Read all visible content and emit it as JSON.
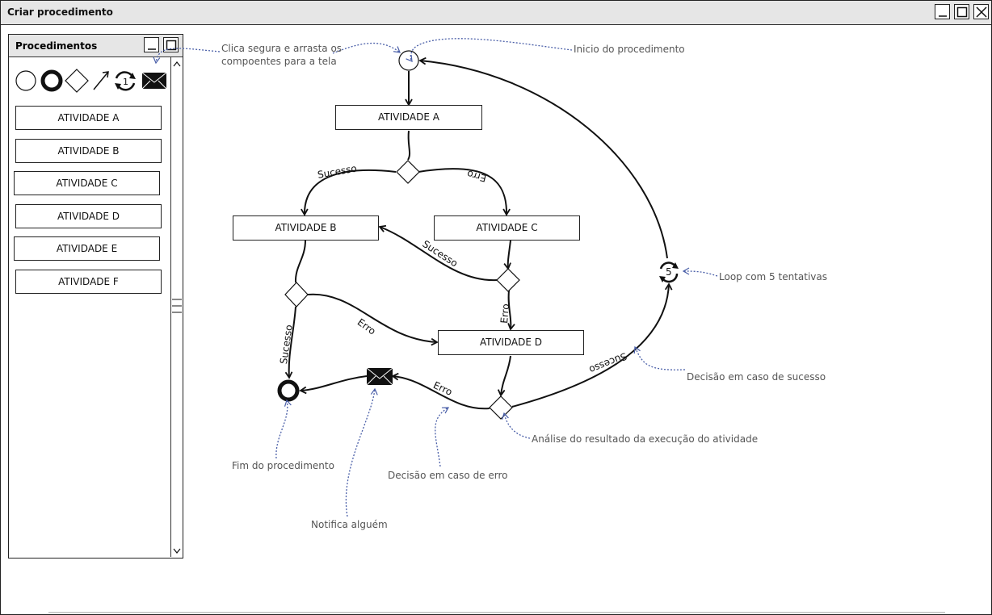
{
  "window": {
    "title": "Criar procedimento"
  },
  "panel": {
    "title": "Procedimentos",
    "tools": [
      "start-event-icon",
      "end-event-icon",
      "decision-icon",
      "arrow-icon",
      "loop-icon",
      "message-icon"
    ],
    "loop_tool_count": "1",
    "activities": [
      "ATIVIDADE A",
      "ATIVIDADE B",
      "ATIVIDADE C",
      "ATIVIDADE D",
      "ATIVIDADE E",
      "ATIVIDADE F"
    ]
  },
  "diagram": {
    "activity_a": "ATIVIDADE A",
    "activity_b": "ATIVIDADE B",
    "activity_c": "ATIVIDADE C",
    "activity_d": "ATIVIDADE D",
    "loop_count": "5",
    "labels": {
      "sucesso_1": "Sucesso",
      "erro_1": "Erro",
      "sucesso_2": "Sucesso",
      "erro_2": "Erro",
      "sucesso_3": "Sucesso",
      "erro_3": "Erro",
      "erro_4": "Erro",
      "sucesso_4": "Sucesso"
    }
  },
  "notes": {
    "drag": "Clica segura e arrasta os",
    "drag_2": "compoentes para a tela",
    "start": "Inicio do procedimento",
    "loop": "Loop com 5 tentativas",
    "success_decision": "Decisão em caso de sucesso",
    "analysis": "Análise do resultado da execução do atividade",
    "error_decision": "Decisão em caso de erro",
    "notify": "Notifica alguém",
    "end": "Fim do procedimento"
  },
  "colors": {
    "annotation": "#4a5fa8",
    "line": "#111111"
  }
}
